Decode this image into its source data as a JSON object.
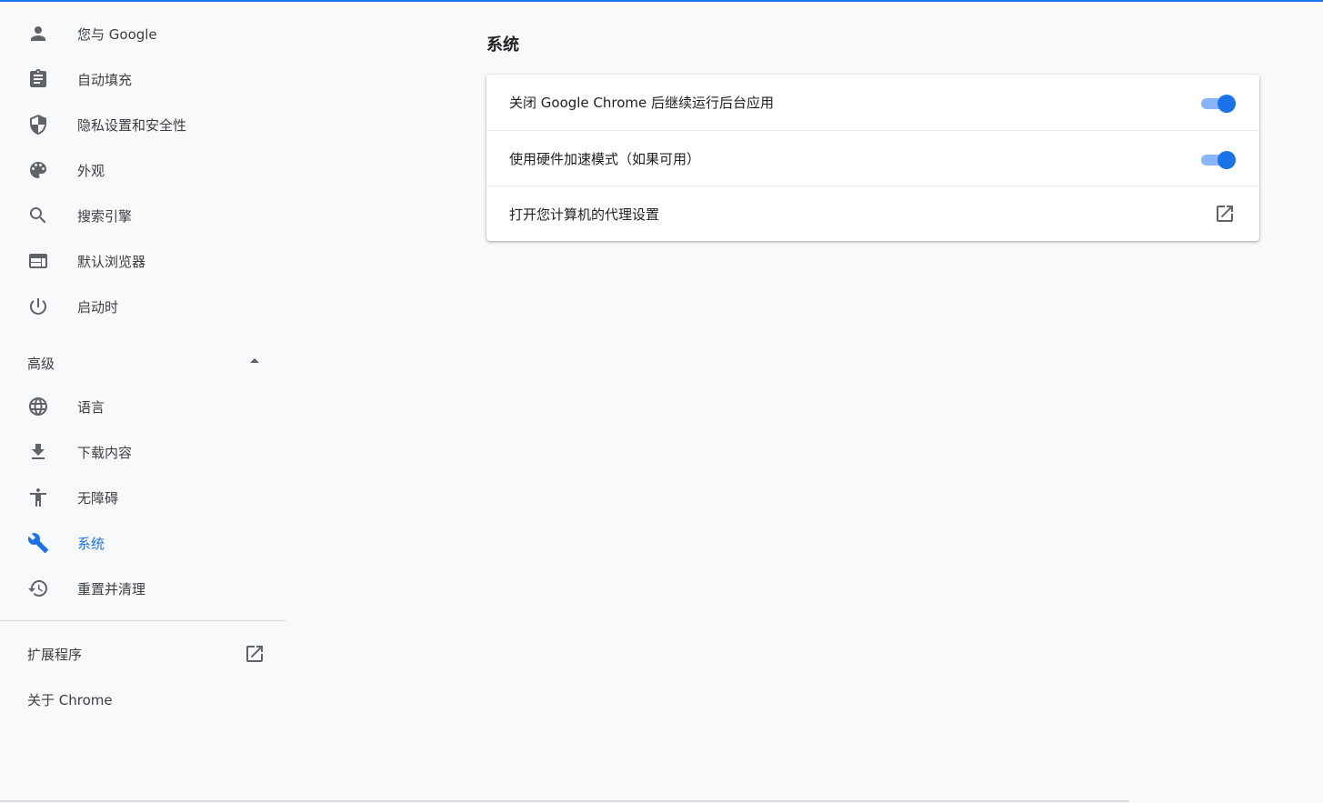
{
  "sidebar": {
    "items": [
      {
        "label": "您与 Google",
        "icon": "person-icon"
      },
      {
        "label": "自动填充",
        "icon": "clipboard-icon"
      },
      {
        "label": "隐私设置和安全性",
        "icon": "shield-icon"
      },
      {
        "label": "外观",
        "icon": "palette-icon"
      },
      {
        "label": "搜索引擎",
        "icon": "search-icon"
      },
      {
        "label": "默认浏览器",
        "icon": "browser-icon"
      },
      {
        "label": "启动时",
        "icon": "power-icon"
      }
    ],
    "advanced": {
      "label": "高级",
      "expanded": true,
      "items": [
        {
          "label": "语言",
          "icon": "globe-icon"
        },
        {
          "label": "下载内容",
          "icon": "download-icon"
        },
        {
          "label": "无障碍",
          "icon": "accessibility-icon"
        },
        {
          "label": "系统",
          "icon": "wrench-icon",
          "active": true
        },
        {
          "label": "重置并清理",
          "icon": "restore-icon"
        }
      ]
    },
    "extensions": {
      "label": "扩展程序",
      "icon": "open-in-new-icon"
    },
    "about": {
      "label": "关于 Chrome"
    }
  },
  "main": {
    "title": "系统",
    "settings": [
      {
        "label": "关闭 Google Chrome 后继续运行后台应用",
        "control": "toggle",
        "enabled": true
      },
      {
        "label": "使用硬件加速模式（如果可用）",
        "control": "toggle",
        "enabled": true
      },
      {
        "label": "打开您计算机的代理设置",
        "control": "external-link",
        "icon": "open-in-new-icon"
      }
    ]
  },
  "colors": {
    "accent": "#1a73e8",
    "toggle_track": "#8ab4f8",
    "background": "#f8f9fa",
    "icon_gray": "#5f6368"
  }
}
